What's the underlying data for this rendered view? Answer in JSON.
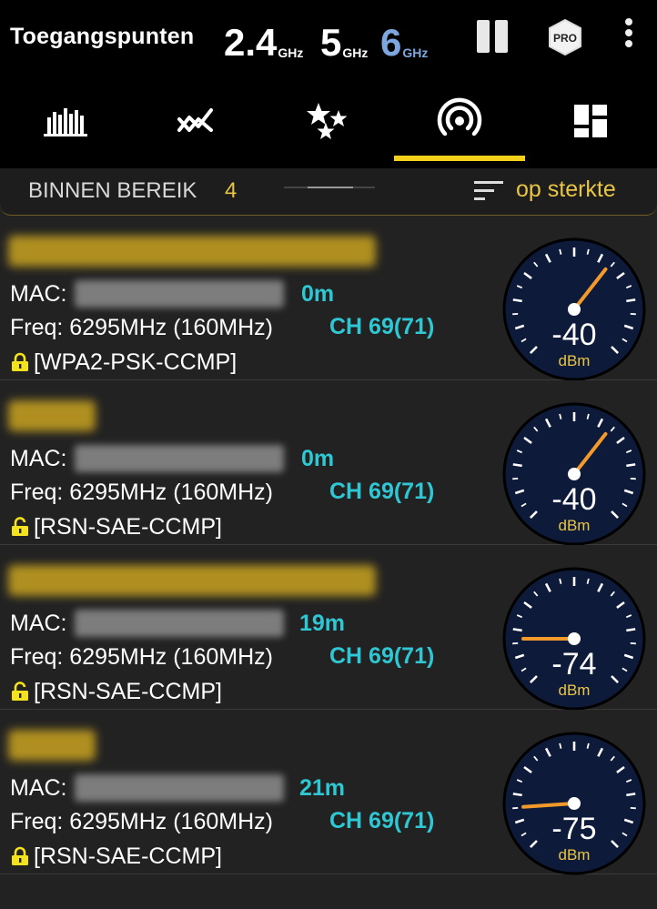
{
  "header": {
    "title": "Toegangspunten",
    "bands": [
      {
        "number": "2.4",
        "unit": "GHz"
      },
      {
        "number": "5",
        "unit": "GHz"
      },
      {
        "number": "6",
        "unit": "GHz"
      }
    ],
    "pro_badge": "PRO"
  },
  "tabs": [
    {
      "name": "channel-graph"
    },
    {
      "name": "time-graph"
    },
    {
      "name": "channel-rating"
    },
    {
      "name": "access-points",
      "selected": true
    },
    {
      "name": "dashboard"
    }
  ],
  "filter": {
    "label": "BINNEN BEREIK",
    "count": "4",
    "sort_label": "op sterkte"
  },
  "colors": {
    "accent": "#f3d01c",
    "cyan": "#2fc7d3",
    "gauge_bg": "#0d1a3a",
    "needle": "#f39a2a"
  },
  "access_points": [
    {
      "mac_label": "MAC:",
      "distance": "0m",
      "freq": "Freq: 6295MHz  (160MHz)",
      "channel": "CH 69(71)",
      "security": "[WPA2-PSK-CCMP]",
      "lock": "closed",
      "signal": "-40",
      "unit": "dBm"
    },
    {
      "mac_label": "MAC:",
      "distance": "0m",
      "freq": "Freq: 6295MHz  (160MHz)",
      "channel": "CH 69(71)",
      "security": "[RSN-SAE-CCMP]",
      "lock": "open",
      "signal": "-40",
      "unit": "dBm"
    },
    {
      "mac_label": "MAC:",
      "distance": "19m",
      "freq": "Freq: 6295MHz  (160MHz)",
      "channel": "CH 69(71)",
      "security": "[RSN-SAE-CCMP]",
      "lock": "open",
      "signal": "-74",
      "unit": "dBm"
    },
    {
      "mac_label": "MAC:",
      "distance": "21m",
      "freq": "Freq: 6295MHz  (160MHz)",
      "channel": "CH 69(71)",
      "security": "[RSN-SAE-CCMP]",
      "lock": "closed",
      "signal": "-75",
      "unit": "dBm"
    }
  ]
}
